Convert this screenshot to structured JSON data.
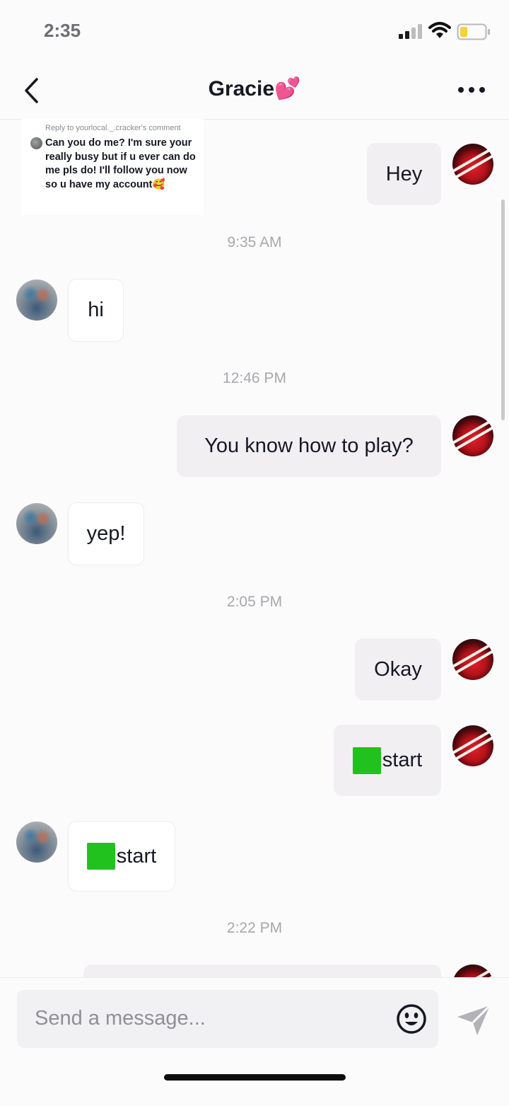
{
  "status_bar": {
    "time": "2:35",
    "battery_color": "#f5d42b"
  },
  "header": {
    "title": "Gracie💕",
    "back_icon": "chevron-left-icon",
    "more_icon": "more-dots-icon"
  },
  "reply_card": {
    "label": "Reply to yourlocal._.cracker's comment",
    "text": "Can you do me? I'm sure your really busy but if u ever can do me pls do! I'll follow you now so u have my account🥰"
  },
  "messages": [
    {
      "kind": "outgoing",
      "text": "Hey"
    },
    {
      "kind": "timestamp",
      "text": "9:35 AM"
    },
    {
      "kind": "incoming",
      "text": "hi"
    },
    {
      "kind": "timestamp",
      "text": "12:46 PM"
    },
    {
      "kind": "outgoing",
      "text": "You know how to play?"
    },
    {
      "kind": "incoming",
      "text": "yep!"
    },
    {
      "kind": "timestamp",
      "text": "2:05 PM"
    },
    {
      "kind": "outgoing",
      "text": "Okay"
    },
    {
      "kind": "outgoing",
      "text": "start",
      "prefix_icon": "green-square-icon"
    },
    {
      "kind": "incoming",
      "text": "start",
      "prefix_icon": "green-square-icon"
    },
    {
      "kind": "timestamp",
      "text": "2:22 PM"
    }
  ],
  "composer": {
    "placeholder": "Send a message...",
    "emoji_icon": "smiley-icon",
    "send_icon": "send-arrow-icon"
  },
  "colors": {
    "green_square": "#21c11e",
    "outgoing_bubble": "#f1eff2",
    "incoming_bubble": "#ffffff"
  }
}
